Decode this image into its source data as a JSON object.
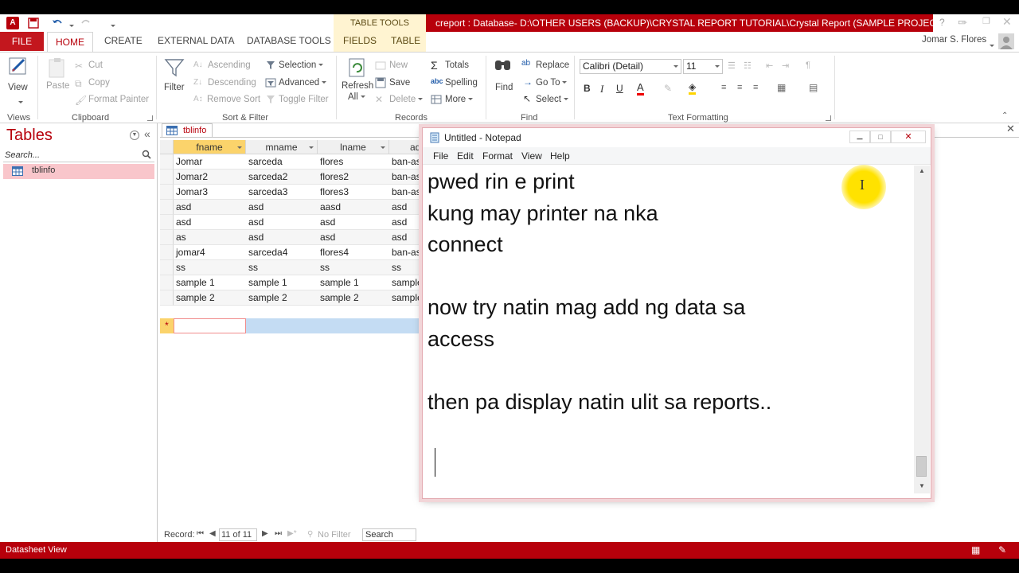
{
  "app": {
    "context_tab": "TABLE TOOLS",
    "window_title": "creport : Database- D:\\OTHER USERS (BACKUP)\\CRYSTAL REPORT TUTORIAL\\Crystal Report (SAMPLE PROJECT)\\creport...",
    "user": "Jomar S. Flores",
    "help": "?"
  },
  "tabs": [
    "FILE",
    "HOME",
    "CREATE",
    "EXTERNAL DATA",
    "DATABASE TOOLS",
    "FIELDS",
    "TABLE"
  ],
  "ribbon": {
    "views": {
      "view": "View",
      "label": "Views"
    },
    "clipboard": {
      "paste": "Paste",
      "cut": "Cut",
      "copy": "Copy",
      "format_painter": "Format Painter",
      "label": "Clipboard"
    },
    "sort_filter": {
      "filter": "Filter",
      "ascending": "Ascending",
      "descending": "Descending",
      "remove_sort": "Remove Sort",
      "selection": "Selection",
      "advanced": "Advanced",
      "toggle_filter": "Toggle Filter",
      "label": "Sort & Filter"
    },
    "records": {
      "refresh": "Refresh",
      "refresh_all": "All",
      "new": "New",
      "save": "Save",
      "delete": "Delete",
      "totals": "Totals",
      "spelling": "Spelling",
      "more": "More",
      "label": "Records"
    },
    "find": {
      "find": "Find",
      "replace": "Replace",
      "goto": "Go To",
      "select": "Select",
      "label": "Find"
    },
    "text_formatting": {
      "font": "Calibri (Detail)",
      "size": "11",
      "bold": "B",
      "italic": "I",
      "underline": "U",
      "label": "Text Formatting"
    }
  },
  "nav": {
    "title": "Tables",
    "search_placeholder": "Search...",
    "items": [
      "tblinfo"
    ]
  },
  "document": {
    "tab": "tblinfo",
    "columns": [
      "fname",
      "mname",
      "lname",
      "ad"
    ],
    "rows": [
      [
        "Jomar",
        "sarceda",
        "flores",
        "ban-as"
      ],
      [
        "Jomar2",
        "sarceda2",
        "flores2",
        "ban-as"
      ],
      [
        "Jomar3",
        "sarceda3",
        "flores3",
        "ban-as"
      ],
      [
        "asd",
        "asd",
        "aasd",
        "asd"
      ],
      [
        "asd",
        "asd",
        "asd",
        "asd"
      ],
      [
        "as",
        "asd",
        "asd",
        "asd"
      ],
      [
        "jomar4",
        "sarceda4",
        "flores4",
        "ban-as"
      ],
      [
        "ss",
        "ss",
        "ss",
        "ss"
      ],
      [
        "sample 1",
        "sample 1",
        "sample 1",
        "sample"
      ],
      [
        "sample 2",
        "sample 2",
        "sample 2",
        "sample"
      ]
    ],
    "new_row_marker": "*"
  },
  "record_bar": {
    "label": "Record:",
    "position": "11 of 11",
    "filter": "No Filter",
    "search": "Search"
  },
  "status": {
    "left": "Datasheet View"
  },
  "notepad": {
    "title": "Untitled - Notepad",
    "menu": [
      "File",
      "Edit",
      "Format",
      "View",
      "Help"
    ],
    "text": "pwed rin e print\nkung may printer na nka\nconnect\n\nnow try natin mag add ng data sa\naccess\n\nthen pa display natin ulit sa reports..\n\n"
  }
}
